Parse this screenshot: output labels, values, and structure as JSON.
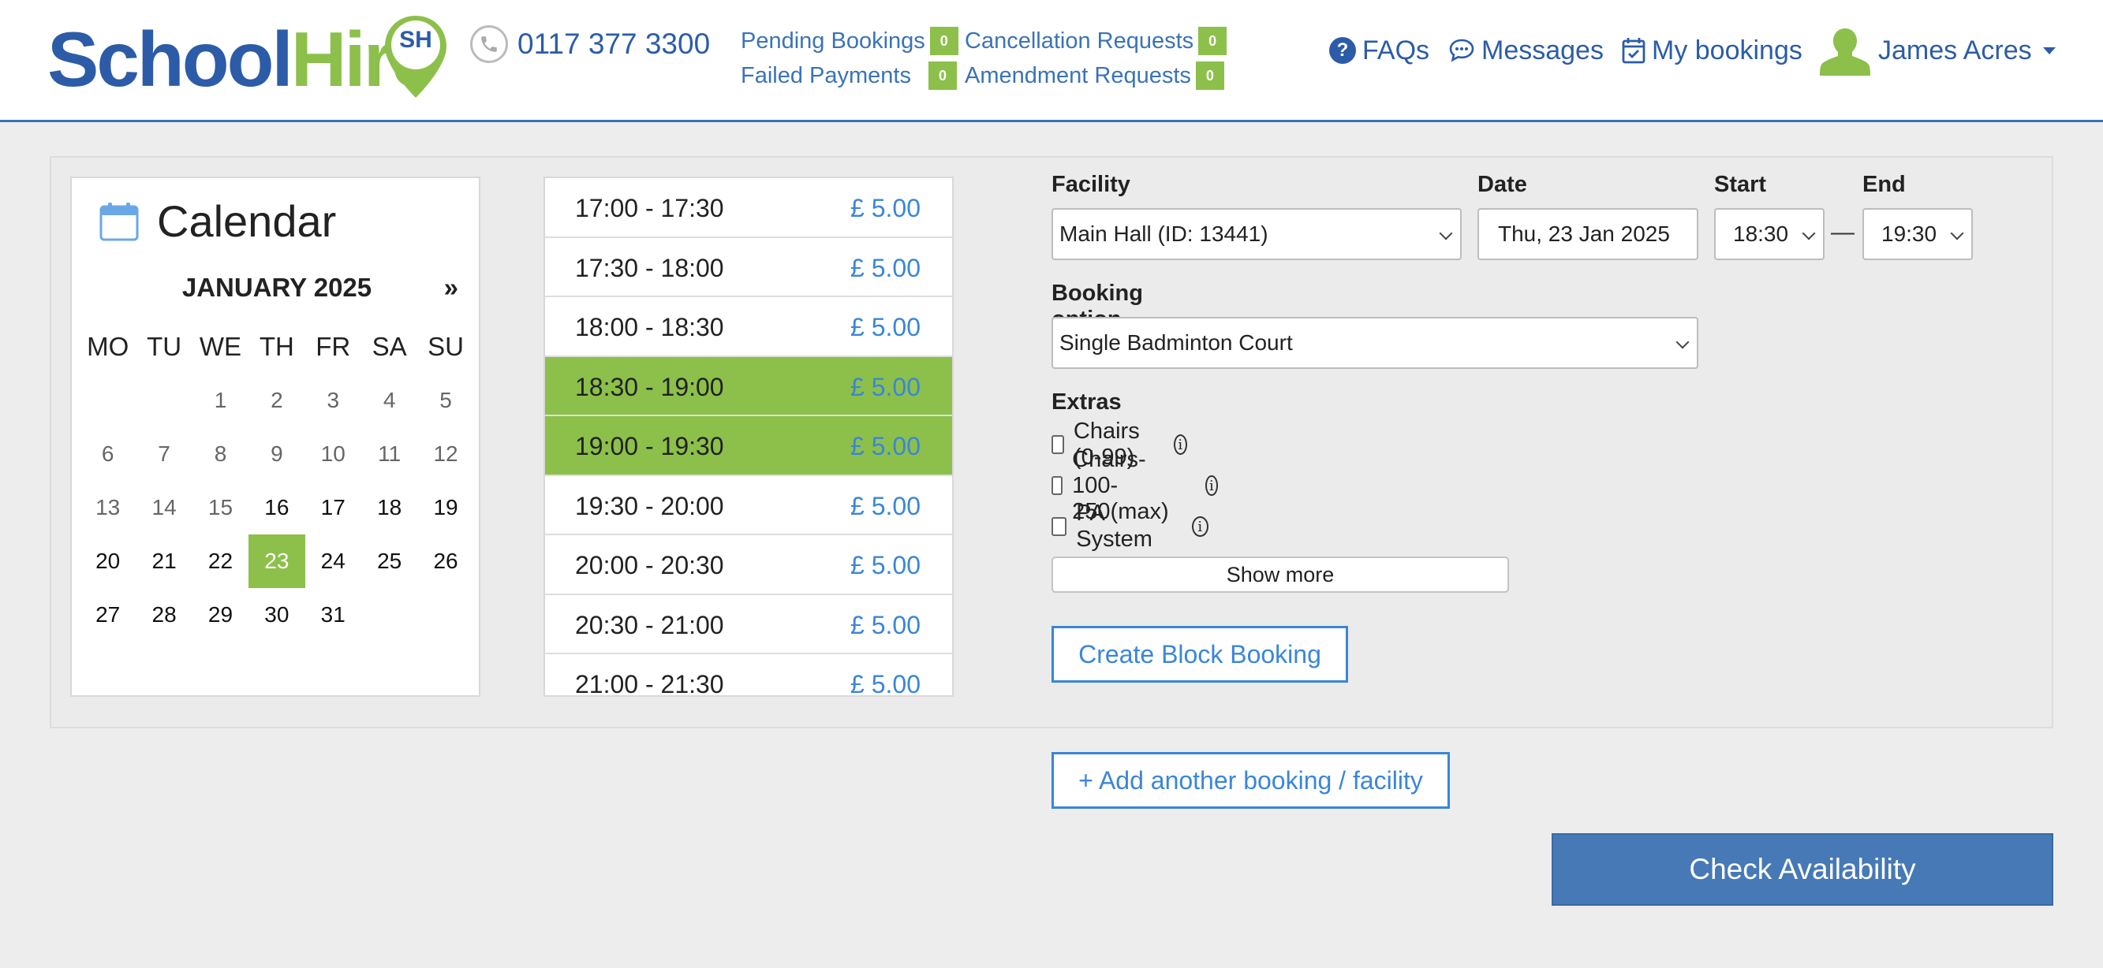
{
  "header": {
    "logo": {
      "part1": "School",
      "part2": "Hire",
      "badge": "SH"
    },
    "phone": "0117 377 3300",
    "counters": [
      {
        "label": "Pending Bookings",
        "count": "0"
      },
      {
        "label": "Failed Payments",
        "count": "0"
      },
      {
        "label": "Cancellation Requests",
        "count": "0"
      },
      {
        "label": "Amendment Requests",
        "count": "0"
      }
    ],
    "nav": {
      "faqs": "FAQs",
      "messages": "Messages",
      "my_bookings": "My bookings",
      "user_name": "James Acres"
    }
  },
  "calendar": {
    "title": "Calendar",
    "month": "JANUARY 2025",
    "next": "»",
    "weekdays": [
      "MO",
      "TU",
      "WE",
      "TH",
      "FR",
      "SA",
      "SU"
    ],
    "weeks": [
      [
        "",
        "",
        "1",
        "2",
        "3",
        "4",
        "5"
      ],
      [
        "6",
        "7",
        "8",
        "9",
        "10",
        "11",
        "12"
      ],
      [
        "13",
        "14",
        "15",
        "16",
        "17",
        "18",
        "19"
      ],
      [
        "20",
        "21",
        "22",
        "23",
        "24",
        "25",
        "26"
      ],
      [
        "27",
        "28",
        "29",
        "30",
        "31",
        "",
        ""
      ]
    ],
    "selected_day": "23",
    "first_available_day": 16
  },
  "slots": [
    {
      "time": "17:00 - 17:30",
      "price": "£ 5.00",
      "selected": false
    },
    {
      "time": "17:30 - 18:00",
      "price": "£ 5.00",
      "selected": false
    },
    {
      "time": "18:00 - 18:30",
      "price": "£ 5.00",
      "selected": false
    },
    {
      "time": "18:30 - 19:00",
      "price": "£ 5.00",
      "selected": true
    },
    {
      "time": "19:00 - 19:30",
      "price": "£ 5.00",
      "selected": true
    },
    {
      "time": "19:30 - 20:00",
      "price": "£ 5.00",
      "selected": false
    },
    {
      "time": "20:00 - 20:30",
      "price": "£ 5.00",
      "selected": false
    },
    {
      "time": "20:30 - 21:00",
      "price": "£ 5.00",
      "selected": false
    },
    {
      "time": "21:00 - 21:30",
      "price": "£ 5.00",
      "selected": false
    }
  ],
  "form": {
    "facility_label": "Facility",
    "facility_value": "Main Hall (ID: 13441)",
    "date_label": "Date",
    "date_value": "Thu, 23 Jan 2025",
    "start_label": "Start",
    "start_value": "18:30",
    "end_label": "End",
    "end_value": "19:30",
    "dash": "—",
    "booking_option_label": "Booking option",
    "booking_option_value": "Single Badminton Court",
    "extras_label": "Extras",
    "extras": [
      {
        "label": "Chairs (0-99)",
        "checked": false
      },
      {
        "label": "Chairs- 100-250(max)",
        "checked": false
      },
      {
        "label": "PA System",
        "checked": false
      }
    ],
    "show_more": "Show more",
    "create_block_booking": "Create Block Booking"
  },
  "add_another": "+ Add another booking / facility",
  "check_availability": "Check Availability",
  "colors": {
    "brand_blue": "#2c5ca8",
    "brand_green": "#8cc04b",
    "link_blue": "#3a86d8",
    "button_blue": "#4679b5"
  }
}
